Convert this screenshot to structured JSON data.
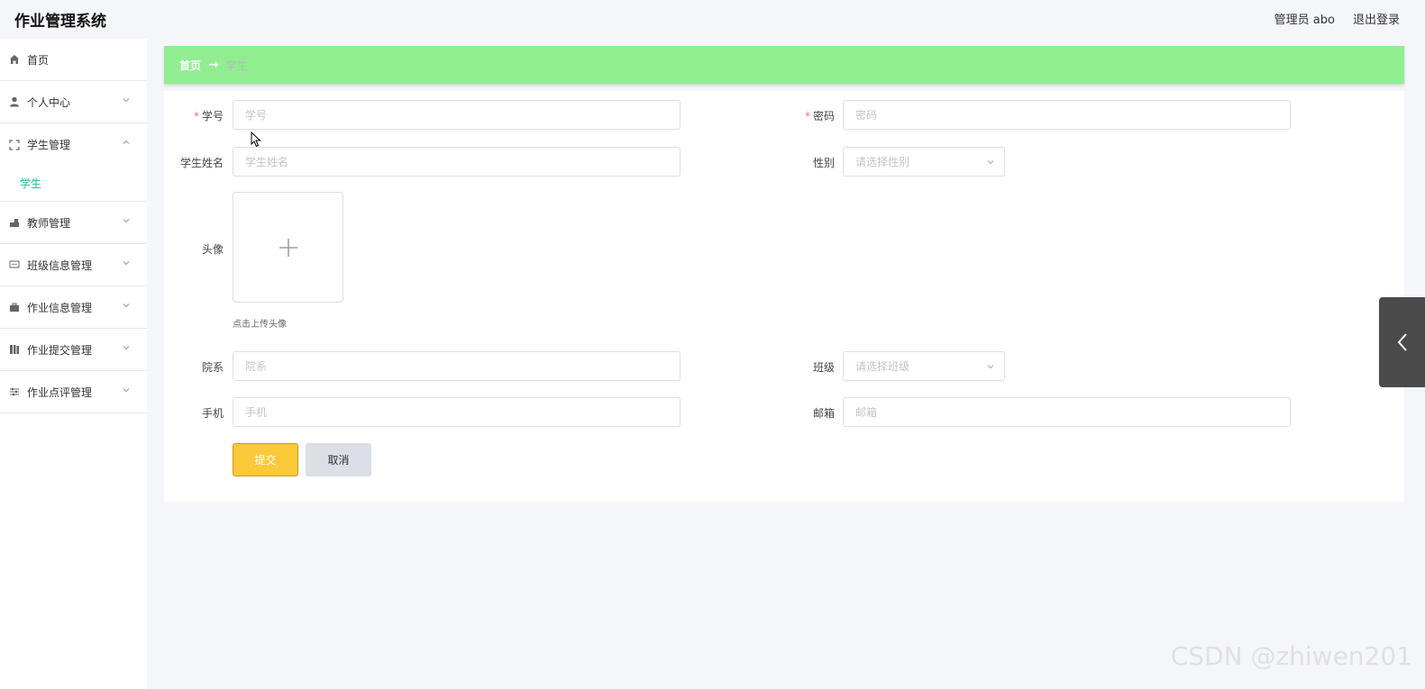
{
  "app": {
    "title": "作业管理系统"
  },
  "header": {
    "user_label": "管理员 abo",
    "logout_label": "退出登录"
  },
  "sidebar": {
    "items": [
      {
        "label": "首页",
        "icon": "home-icon"
      },
      {
        "label": "个人中心",
        "icon": "user-icon"
      },
      {
        "label": "学生管理",
        "icon": "scan-icon",
        "expanded": true,
        "children": [
          "学生"
        ]
      },
      {
        "label": "教师管理",
        "icon": "teacher-icon"
      },
      {
        "label": "班级信息管理",
        "icon": "chat-icon"
      },
      {
        "label": "作业信息管理",
        "icon": "briefcase-icon"
      },
      {
        "label": "作业提交管理",
        "icon": "books-icon"
      },
      {
        "label": "作业点评管理",
        "icon": "sliders-icon"
      }
    ],
    "active_child": "学生"
  },
  "breadcrumb": {
    "home": "首页",
    "separator": "→",
    "current": "学生"
  },
  "form": {
    "student_no": {
      "label": "学号",
      "required": "*",
      "placeholder": "学号",
      "value": ""
    },
    "password": {
      "label": "密码",
      "required": "*",
      "placeholder": "密码",
      "value": ""
    },
    "student_name": {
      "label": "学生姓名",
      "placeholder": "学生姓名",
      "value": ""
    },
    "gender": {
      "label": "性别",
      "placeholder": "请选择性别"
    },
    "avatar": {
      "label": "头像",
      "hint": "点击上传头像"
    },
    "department": {
      "label": "院系",
      "placeholder": "院系",
      "value": ""
    },
    "class": {
      "label": "班级",
      "placeholder": "请选择班级"
    },
    "phone": {
      "label": "手机",
      "placeholder": "手机",
      "value": ""
    },
    "email": {
      "label": "邮箱",
      "placeholder": "邮箱",
      "value": ""
    },
    "submit_label": "提交",
    "cancel_label": "取消"
  },
  "watermark": "CSDN @zhiwen201",
  "colors": {
    "breadcrumb_bg": "#90ee90",
    "active_menu": "#2eb398",
    "submit_bg": "#f9c93a",
    "cancel_bg": "#dcdfe6",
    "required": "#f56c6c"
  }
}
